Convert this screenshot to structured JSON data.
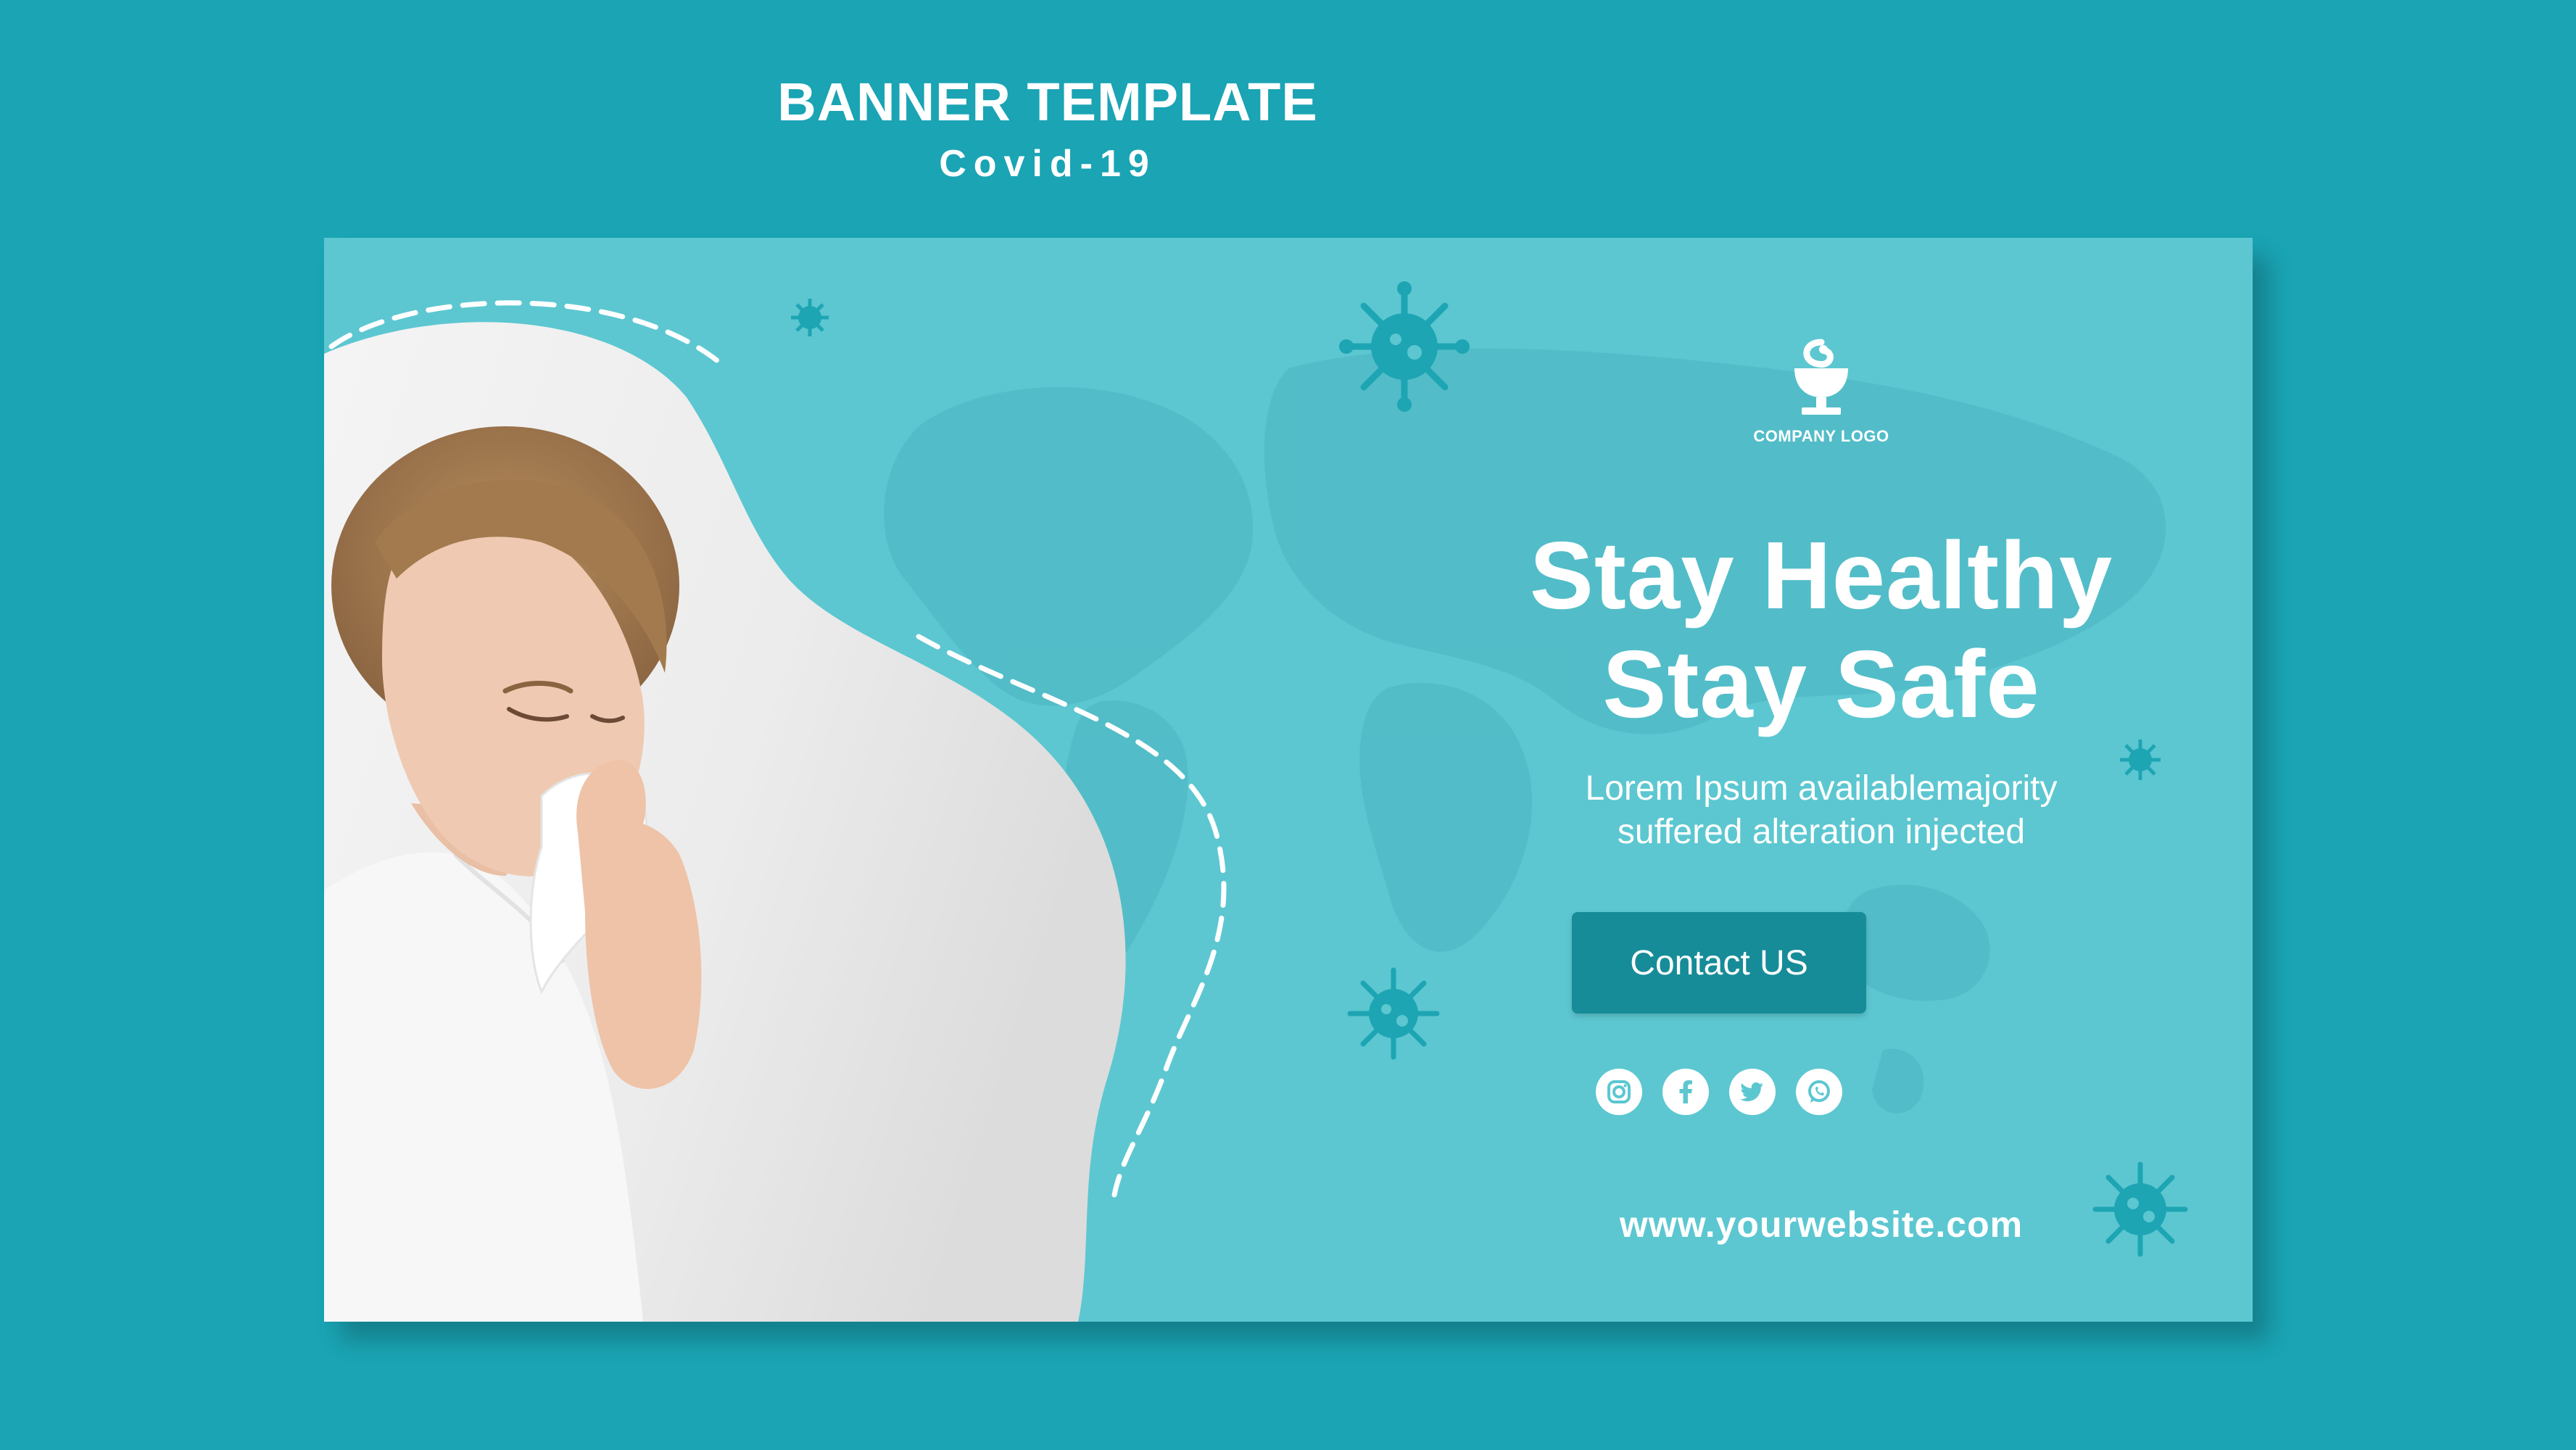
{
  "header": {
    "title": "BANNER TEMPLATE",
    "subtitle": "Covid-19"
  },
  "banner": {
    "logo_text": "COMPANY LOGO",
    "headline_line1": "Stay Healthy",
    "headline_line2": "Stay Safe",
    "body_line1": "Lorem Ipsum availablemajority",
    "body_line2": "suffered alteration injected",
    "cta_label": "Contact US",
    "social_icons": [
      "instagram-icon",
      "facebook-icon",
      "twitter-icon",
      "whatsapp-icon"
    ],
    "website": "www.yourwebsite.com"
  },
  "colors": {
    "page_background": "#1aa4b4",
    "banner_background": "#5cc7d1",
    "button_background": "#178c99",
    "virus_icon": "#1ea5b3",
    "text": "#ffffff"
  }
}
